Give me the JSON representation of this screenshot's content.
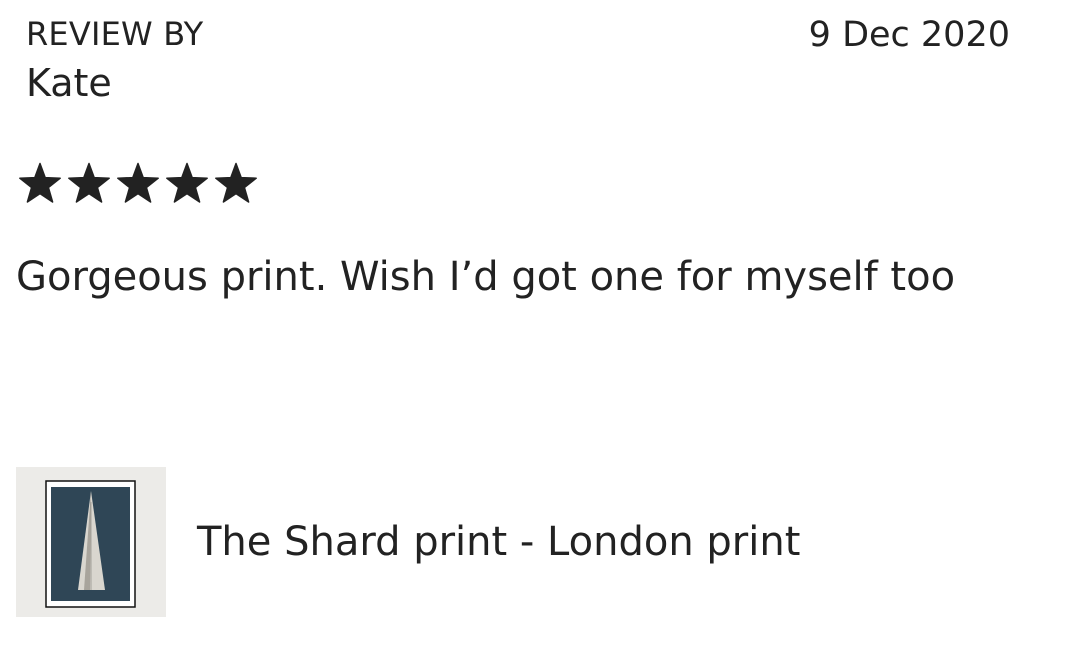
{
  "review": {
    "label": "REVIEW BY",
    "reviewer": "Kate",
    "date": "9 Dec 2020",
    "rating": 5,
    "rating_max": 5,
    "text": "Gorgeous print. Wish I’d got one for myself too"
  },
  "product": {
    "title": "The Shard print - London print",
    "thumbnail_icon": "framed-shard-print-thumbnail"
  },
  "colors": {
    "text": "#222222",
    "star": "#222222",
    "print_background": "#2f4656",
    "thumbnail_background": "#ecebe8"
  }
}
